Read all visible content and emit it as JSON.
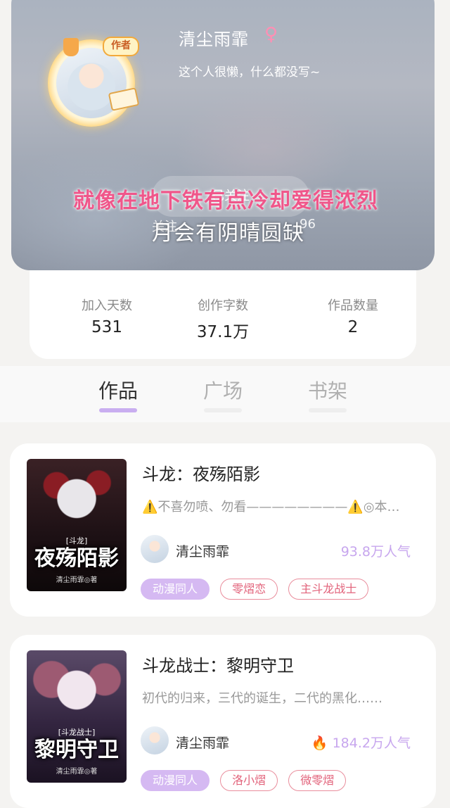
{
  "profile": {
    "author_badge": "作者",
    "nickname": "清尘雨霏",
    "gender_symbol": "♀",
    "bio": "这个人很懒，什么都没写~",
    "follow_label": "已关注",
    "stat_fragment_left": "关注",
    "stat_fragment_right": "96"
  },
  "overlay": {
    "lyric_line1": "就像在地下铁有点冷却爱得浓烈",
    "lyric_line2": "月会有阴晴圆缺"
  },
  "stats": [
    {
      "label": "加入天数",
      "value": "531"
    },
    {
      "label": "创作字数",
      "value": "37.1万"
    },
    {
      "label": "作品数量",
      "value": "2"
    }
  ],
  "tabs": [
    {
      "label": "作品",
      "active": true
    },
    {
      "label": "广场",
      "active": false
    },
    {
      "label": "书架",
      "active": false
    }
  ],
  "books": [
    {
      "title": "斗龙：夜殇陌影",
      "description": "⚠️不喜勿喷、勿看————————⚠️◎本…",
      "author": "清尘雨霏",
      "popularity": "93.8万人气",
      "show_fire_icon": false,
      "cover": {
        "series": "[斗龙]",
        "title": "夜殇陌影",
        "author": "清尘雨霏◎著"
      },
      "tags": [
        {
          "label": "动漫同人",
          "style": "filled"
        },
        {
          "label": "零熠恋",
          "style": "outline"
        },
        {
          "label": "主斗龙战士",
          "style": "outline"
        }
      ]
    },
    {
      "title": "斗龙战士：黎明守卫",
      "description": "初代的归来，三代的诞生，二代的黑化……",
      "author": "清尘雨霏",
      "popularity": "184.2万人气",
      "show_fire_icon": true,
      "cover": {
        "series": "[斗龙战士]",
        "title": "黎明守卫",
        "author": "清尘雨霏◎著"
      },
      "tags": [
        {
          "label": "动漫同人",
          "style": "filled"
        },
        {
          "label": "洛小熠",
          "style": "outline"
        },
        {
          "label": "微零熠",
          "style": "outline"
        }
      ]
    }
  ]
}
